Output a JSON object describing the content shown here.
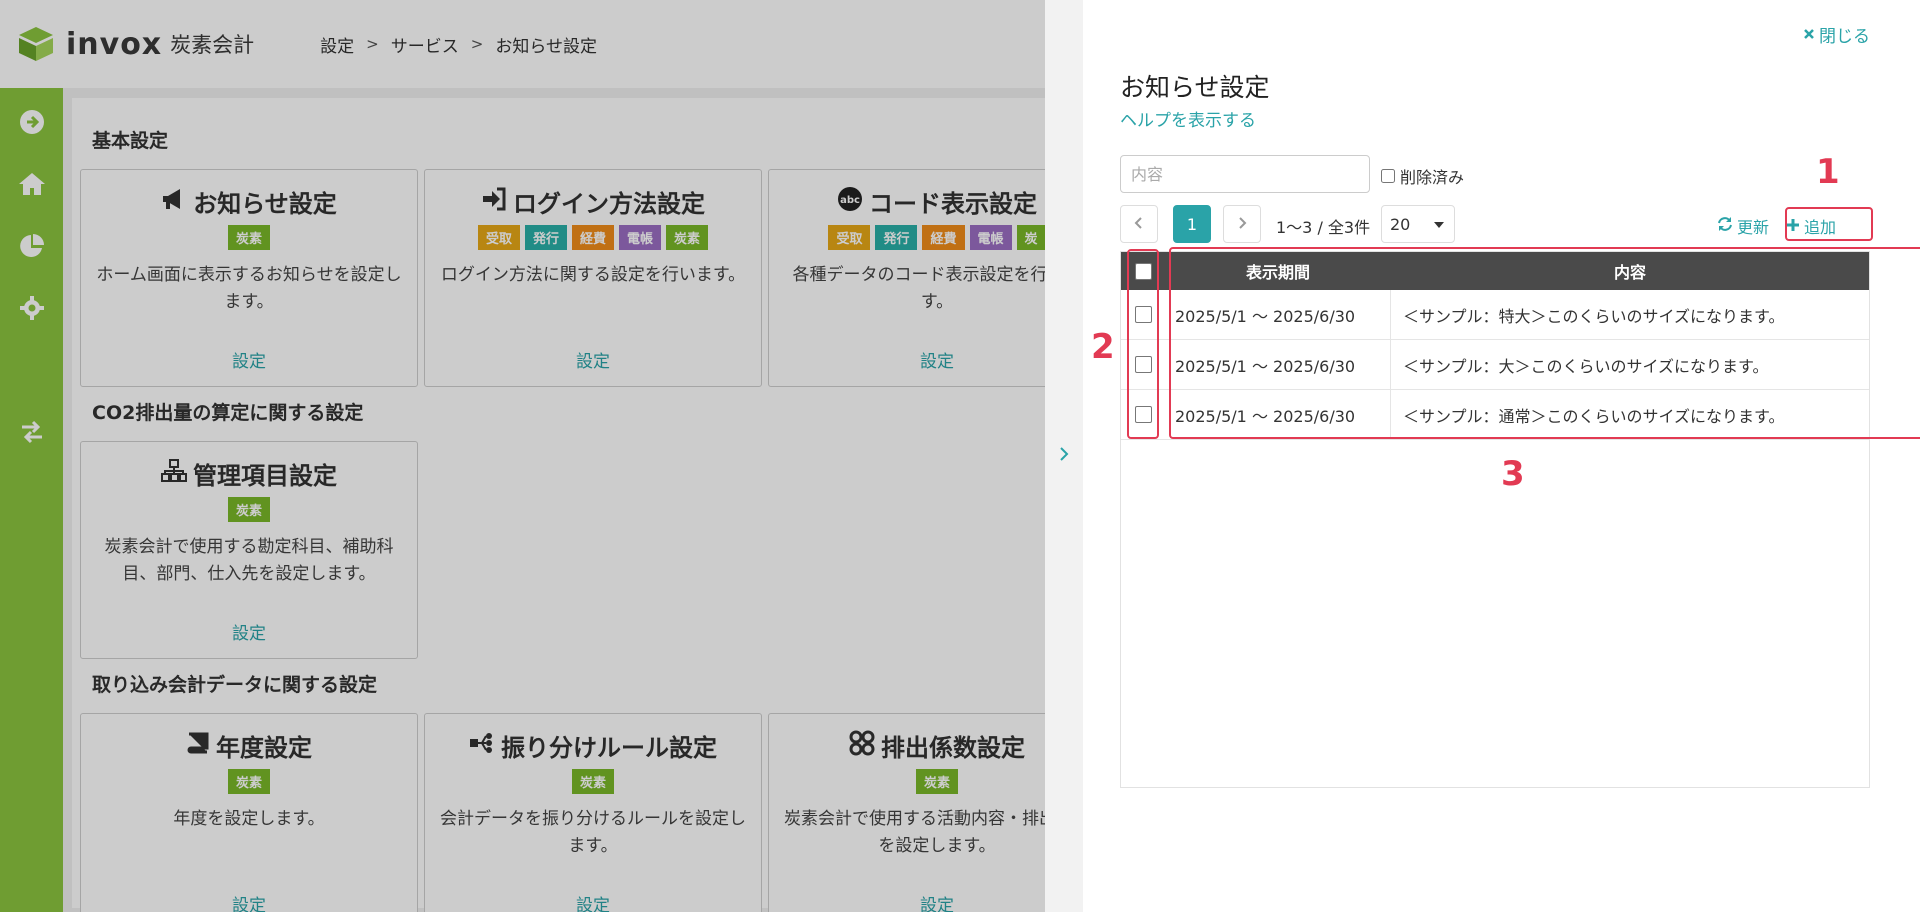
{
  "app": {
    "logo_text": "invox",
    "logo_sub": "炭素会計",
    "breadcrumb": [
      "設定",
      "サービス",
      "お知らせ設定"
    ]
  },
  "sidebar": {
    "icons": [
      "arrow-circle-right-icon",
      "home-icon",
      "pie-chart-icon",
      "gear-icon",
      "transfer-icon"
    ]
  },
  "sections": [
    {
      "title": "基本設定",
      "cards": [
        {
          "icon": "megaphone-icon",
          "title": "お知らせ設定",
          "tags": [
            "炭素"
          ],
          "desc": "ホーム画面に表示するお知らせを設定します。",
          "link": "設定"
        },
        {
          "icon": "sign-in-icon",
          "title": "ログイン方法設定",
          "tags": [
            "受取",
            "発行",
            "経費",
            "電帳",
            "炭素"
          ],
          "desc": "ログイン方法に関する設定を行います。",
          "link": "設定"
        },
        {
          "icon": "abc-icon",
          "title": "コード表示設定",
          "tags": [
            "受取",
            "発行",
            "経費",
            "電帳",
            "炭"
          ],
          "desc": "各種データのコード表示設定を行います。",
          "link": "設定"
        }
      ]
    },
    {
      "title": "CO2排出量の算定に関する設定",
      "cards": [
        {
          "icon": "sitemap-icon",
          "title": "管理項目設定",
          "tags": [
            "炭素"
          ],
          "desc": "炭素会計で使用する勘定科目、補助科目、部門、仕入先を設定します。",
          "link": "設定"
        }
      ]
    },
    {
      "title": "取り込み会計データに関する設定",
      "cards": [
        {
          "icon": "book-icon",
          "title": "年度設定",
          "tags": [
            "炭素"
          ],
          "desc": "年度を設定します。",
          "link": "設定"
        },
        {
          "icon": "route-icon",
          "title": "振り分けルール設定",
          "tags": [
            "炭素"
          ],
          "desc": "会計データを振り分けるルールを設定します。",
          "link": "設定"
        },
        {
          "icon": "grid-circles-icon",
          "title": "排出係数設定",
          "tags": [
            "炭素"
          ],
          "desc": "炭素会計で使用する活動内容・排出係数を設定します。",
          "link": "設定"
        }
      ]
    }
  ],
  "tag_colors": {
    "受取": "#e6a817",
    "発行": "#2ab0a8",
    "経費": "#f08c1a",
    "電帳": "#9b6fc4",
    "炭素": "#7ab829",
    "炭": "#7ab829"
  },
  "panel": {
    "close_label": "閉じる",
    "title": "お知らせ設定",
    "help_link": "ヘルプを表示する",
    "search_placeholder": "内容",
    "deleted_label": "削除済み",
    "current_page": "1",
    "page_info": "1〜3 / 全3件",
    "page_size": "20",
    "refresh_label": "更新",
    "add_label": "追加",
    "columns": [
      "表示期間",
      "内容"
    ],
    "rows": [
      {
        "period": "2025/5/1 〜 2025/6/30",
        "content": "＜サンプル：特大＞このくらいのサイズになります。"
      },
      {
        "period": "2025/5/1 〜 2025/6/30",
        "content": "＜サンプル：大＞このくらいのサイズになります。"
      },
      {
        "period": "2025/5/1 〜 2025/6/30",
        "content": "＜サンプル：通常＞このくらいのサイズになります。"
      }
    ]
  },
  "annotations": [
    "1",
    "2",
    "3"
  ],
  "colors": {
    "accent": "#2aa3a8",
    "sidebar": "#8bc53f",
    "annotation": "#e23a53",
    "table_header": "#4a4a4a"
  }
}
